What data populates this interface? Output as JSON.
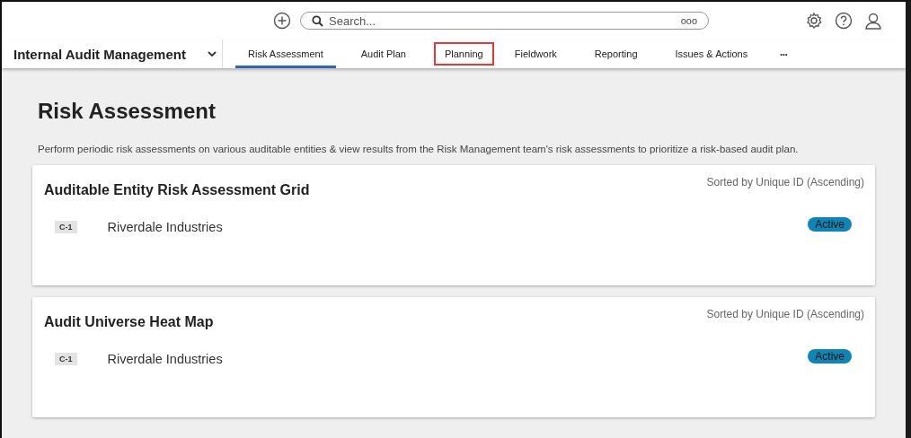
{
  "top_bar": {
    "search": {
      "placeholder": "Search...",
      "badge": "ooo"
    }
  },
  "nav": {
    "app_name": "Internal Audit Management",
    "tabs": [
      {
        "label": "Risk Assessment",
        "selected": true,
        "highlighted": false
      },
      {
        "label": "Audit Plan",
        "selected": false,
        "highlighted": false
      },
      {
        "label": "Planning",
        "selected": false,
        "highlighted": true
      },
      {
        "label": "Fieldwork",
        "selected": false,
        "highlighted": false
      },
      {
        "label": "Reporting",
        "selected": false,
        "highlighted": false
      },
      {
        "label": "Issues & Actions",
        "selected": false,
        "highlighted": false
      }
    ],
    "more": "•••"
  },
  "page": {
    "title": "Risk Assessment",
    "description": "Perform periodic risk assessments on various auditable entities & view results from the Risk Management team's risk assessments to prioritize a risk-based audit plan."
  },
  "cards": [
    {
      "title": "Auditable Entity Risk Assessment Grid",
      "sort_note": "Sorted by Unique ID (Ascending)",
      "rows": [
        {
          "id": "C-1",
          "name": "Riverdale Industries",
          "status": "Active"
        }
      ]
    },
    {
      "title": "Audit Universe Heat Map",
      "sort_note": "Sorted by Unique ID (Ascending)",
      "rows": [
        {
          "id": "C-1",
          "name": "Riverdale Industries",
          "status": "Active"
        }
      ]
    }
  ]
}
